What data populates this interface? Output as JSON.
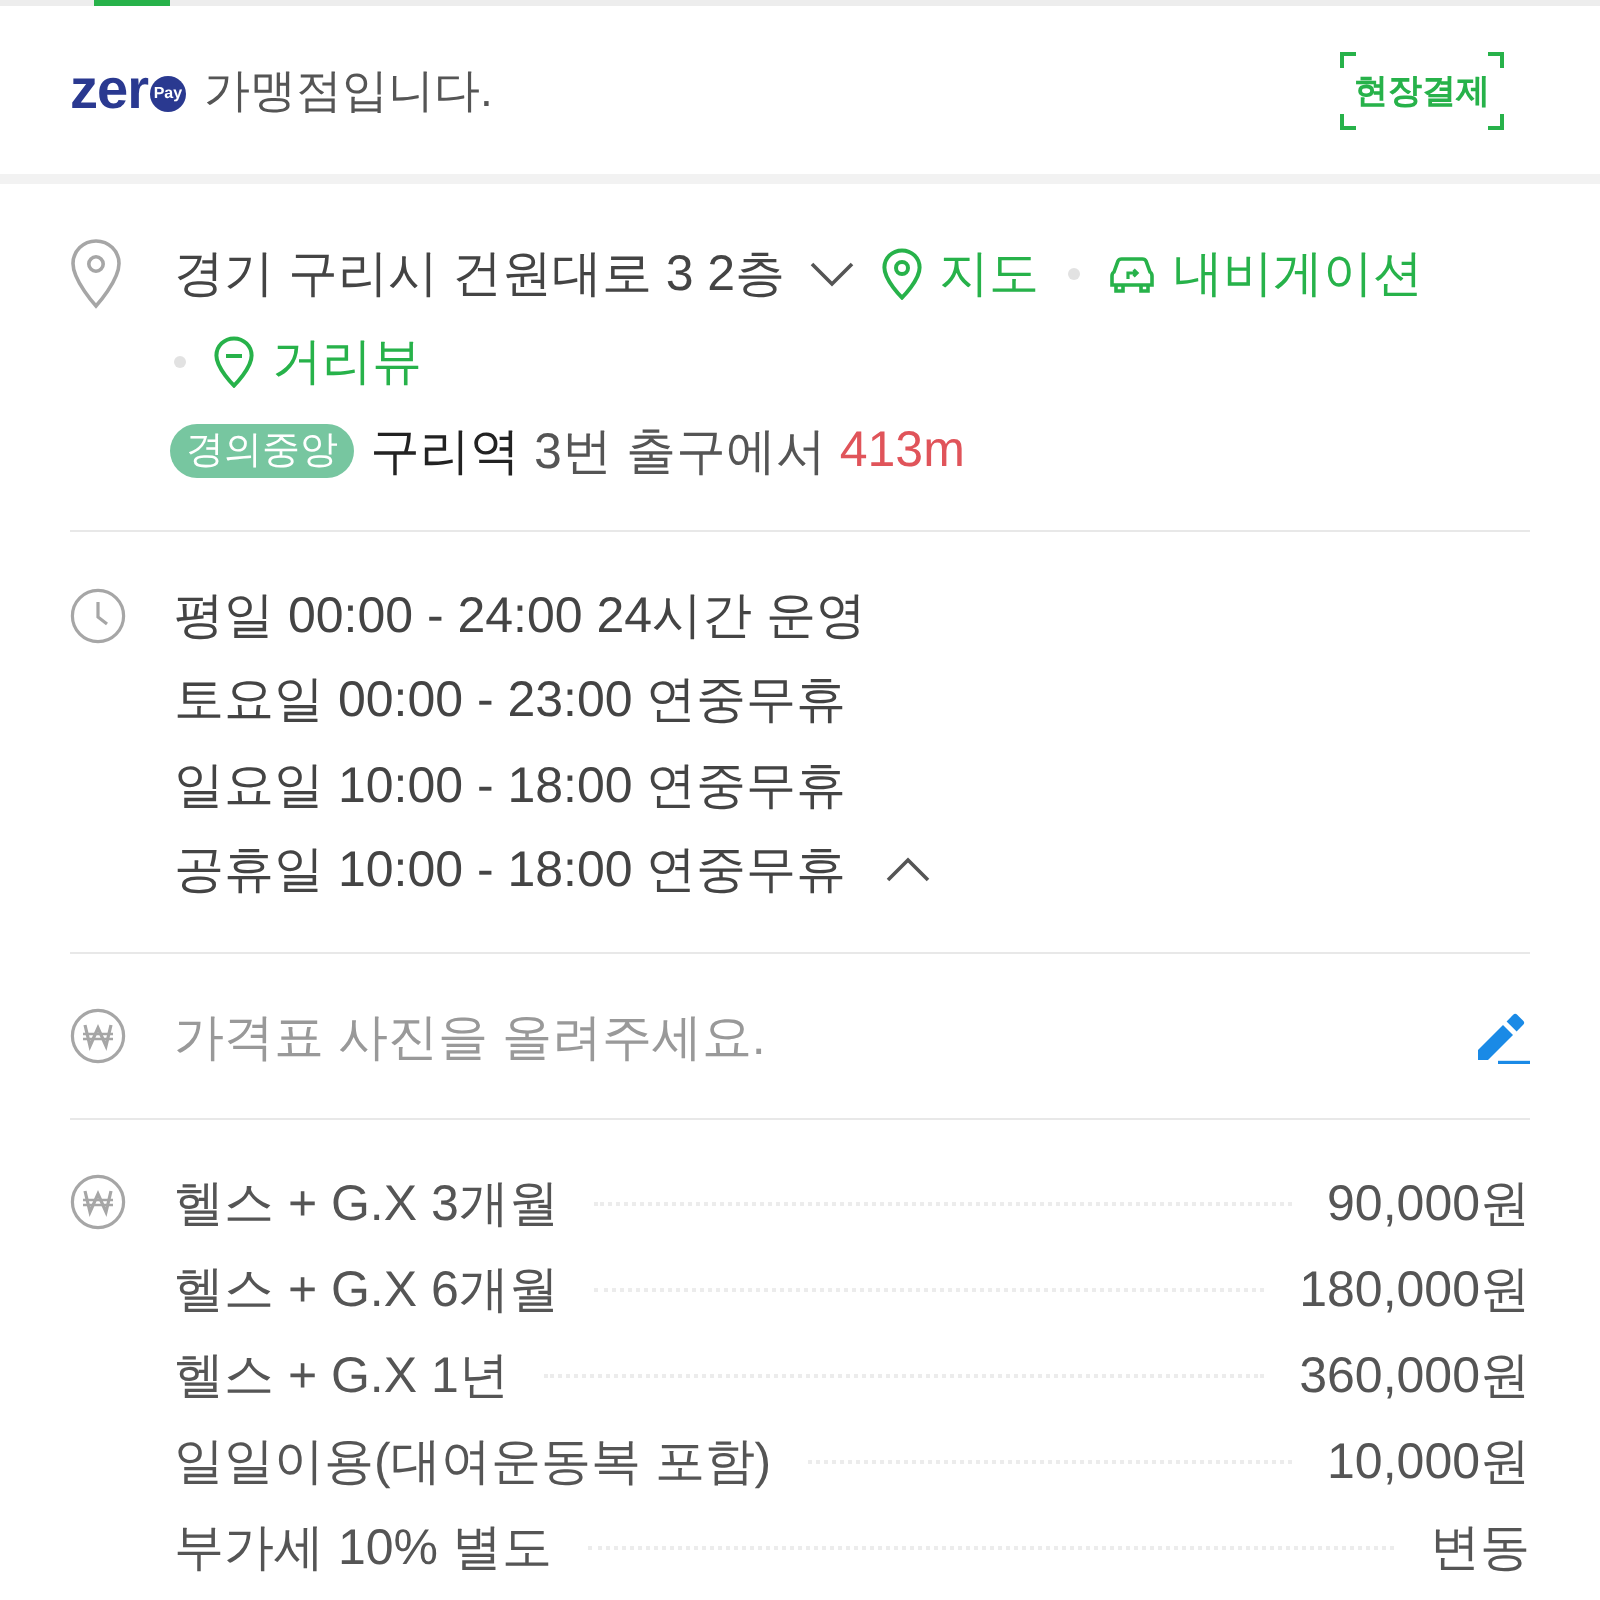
{
  "header": {
    "logo": {
      "wordmark": "zer",
      "badge": "Pay"
    },
    "notice": "가맹점입니다.",
    "payment_badge": "현장결제"
  },
  "address": {
    "text": "경기 구리시 건원대로 3 2층",
    "expanded": false,
    "links": [
      {
        "kind": "map",
        "label": "지도"
      },
      {
        "kind": "navigation",
        "label": "내비게이션"
      },
      {
        "kind": "street_view",
        "label": "거리뷰"
      }
    ],
    "transit": [
      {
        "line": "경의중앙",
        "color": "#77c6a0",
        "station": "구리역",
        "exit": "3번 출구에서",
        "distance": "413m"
      }
    ]
  },
  "hours": {
    "expanded": true,
    "lines": [
      "평일 00:00 - 24:00 24시간 운영",
      "토요일 00:00 - 23:00 연중무휴",
      "일요일 10:00 - 18:00 연중무휴",
      "공휴일 10:00 - 18:00 연중무휴"
    ]
  },
  "price_photo": {
    "prompt": "가격표 사진을 올려주세요."
  },
  "prices": [
    {
      "name": "헬스 + G.X 3개월",
      "price": "90,000원"
    },
    {
      "name": "헬스 + G.X 6개월",
      "price": "180,000원"
    },
    {
      "name": "헬스 + G.X 1년",
      "price": "360,000원"
    },
    {
      "name": "일일이용(대여운동복 포함)",
      "price": "10,000원"
    },
    {
      "name": "부가세 10% 별도",
      "price": "변동"
    }
  ]
}
